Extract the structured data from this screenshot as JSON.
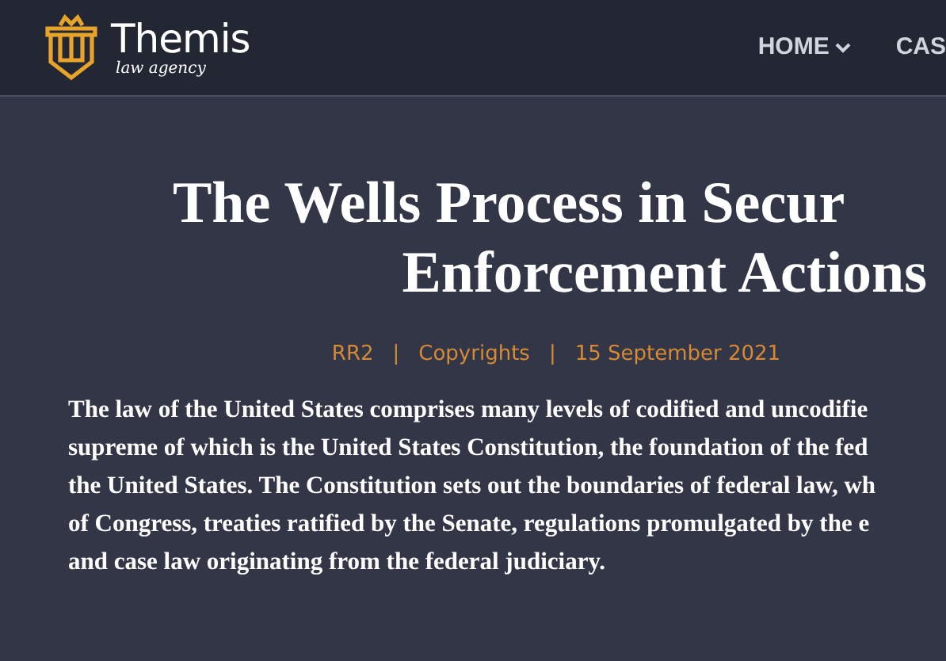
{
  "header": {
    "logo": {
      "name": "Themis",
      "tagline": "law agency"
    },
    "nav": [
      {
        "label": "HOME",
        "dropdown": true
      },
      {
        "label": "CAS",
        "dropdown": false
      }
    ]
  },
  "article": {
    "title_lines": [
      "The Wells Process in Secur",
      "Enforcement Actions"
    ],
    "meta": [
      "RR2",
      "Copyrights",
      "15 September 2021"
    ],
    "meta_separator": "|",
    "body_lines": [
      "The law of the United States comprises many levels of codified and uncodifie",
      "supreme of which is the United States Constitution, the foundation of the fed",
      "the United States. The Constitution sets out the boundaries of federal law, wh",
      "of Congress, treaties ratified by the Senate, regulations promulgated by the e",
      "and case law originating from the federal judiciary."
    ]
  }
}
